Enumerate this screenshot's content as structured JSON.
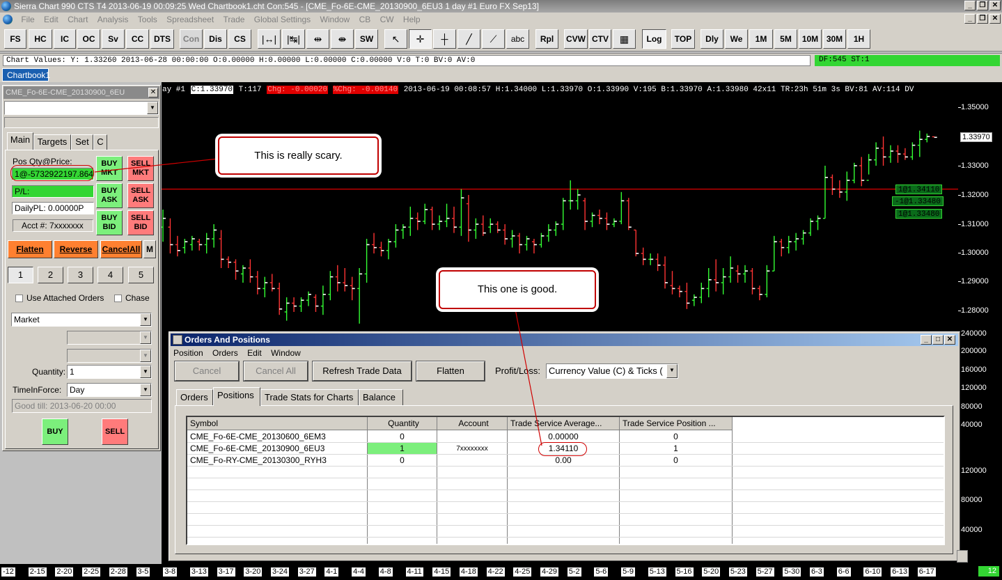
{
  "window": {
    "title": "Sierra Chart 990 CTS T4 2013-06-19  00:09:25 Wed  Chartbook1.cht Con:545 - [CME_Fo-6E-CME_20130900_6EU3  1 day  #1  Euro FX Sep13]"
  },
  "menu": [
    "File",
    "Edit",
    "Chart",
    "Analysis",
    "Tools",
    "Spreadsheet",
    "Trade",
    "Global Settings",
    "Window",
    "CB",
    "CW",
    "Help"
  ],
  "toolbar": {
    "buttons": [
      "FS",
      "HC",
      "IC",
      "OC",
      "Sv",
      "CC",
      "DTS",
      "Con",
      "Dis",
      "CS",
      "SW",
      "abc",
      "Rpl",
      "CVW",
      "CTV",
      "Log",
      "TOP",
      "Dly",
      "We",
      "1M",
      "5M",
      "10M",
      "30M",
      "1H"
    ]
  },
  "values_bar": {
    "text": "Chart Values: Y: 1.33260  2013-06-28  00:00:00  O:0.00000  H:0.00000  L:0.00000  C:0.00000  V:0  T:0  BV:0  AV:0",
    "df": "DF:545  ST:1"
  },
  "chartbook_tab": "Chartbook1",
  "trade_window": {
    "title": "CME_Fo-6E-CME_20130900_6EU",
    "tabs": [
      "Main",
      "Targets",
      "Set",
      "C"
    ],
    "pos_label": "Pos Qty@Price:",
    "pos_value": "1@-5732922197.864",
    "pl_label": "P/L:",
    "daily_pl": "DailyPL: 0.00000P",
    "acct": "Acct #: 7xxxxxxx",
    "buttons": {
      "buy_mkt": [
        "BUY",
        "MKT"
      ],
      "sell_mkt": [
        "SELL",
        "MKT"
      ],
      "buy_ask": [
        "BUY",
        "ASK"
      ],
      "sell_ask": [
        "SELL",
        "ASK"
      ],
      "buy_bid": [
        "BUY",
        "BID"
      ],
      "sell_bid": [
        "SELL",
        "BID"
      ]
    },
    "flatten": "Flatten",
    "reverse": "Reverse",
    "cancel_all": "CancelAll",
    "m": "M",
    "numbers": [
      "1",
      "2",
      "3",
      "4",
      "5"
    ],
    "use_attached": "Use Attached Orders",
    "chase": "Chase",
    "order_type": "Market",
    "quantity_label": "Quantity:",
    "quantity": "1",
    "tif_label": "TimeInForce:",
    "tif": "Day",
    "good_till": "Good till: 2013-06-20 00:00",
    "buy": "BUY",
    "sell": "SELL"
  },
  "chart": {
    "info": {
      "prefix": "ay   #1 ",
      "c": "C:1.33970",
      "t": " T:117 ",
      "chg": "Chg: -0.00020",
      "pchg": "%Chg: -0.00140",
      "rest": " 2013-06-19 00:08:57 H:1.34000 L:1.33970 O:1.33990 V:195 B:1.33970 A:1.33980 42x11 TR:23h 51m 3s BV:81 AV:114 DV"
    },
    "order_labels": [
      "1@1.34110",
      "-1@1.33480",
      "1@1.33480"
    ],
    "colors": {
      "up": "#33ff33",
      "down": "#ff3333",
      "close_tick": "#ffffff",
      "hline": "#c00000"
    },
    "bars": [
      [
        1.315,
        1.304,
        1.309,
        1.312
      ],
      [
        1.312,
        1.3,
        1.309,
        1.303
      ],
      [
        1.306,
        1.299,
        1.303,
        1.301
      ],
      [
        1.305,
        1.3,
        1.302,
        1.304
      ],
      [
        1.306,
        1.301,
        1.303,
        1.305
      ],
      [
        1.305,
        1.301,
        1.304,
        1.303
      ],
      [
        1.307,
        1.3,
        1.303,
        1.305
      ],
      [
        1.31,
        1.302,
        1.305,
        1.308
      ],
      [
        1.308,
        1.295,
        1.305,
        1.298
      ],
      [
        1.299,
        1.295,
        1.298,
        1.297
      ],
      [
        1.298,
        1.291,
        1.297,
        1.294
      ],
      [
        1.296,
        1.29,
        1.293,
        1.295
      ],
      [
        1.298,
        1.29,
        1.295,
        1.292
      ],
      [
        1.294,
        1.286,
        1.292,
        1.288
      ],
      [
        1.292,
        1.285,
        1.288,
        1.29
      ],
      [
        1.293,
        1.287,
        1.29,
        1.288
      ],
      [
        1.29,
        1.279,
        1.288,
        1.281
      ],
      [
        1.285,
        1.277,
        1.28,
        1.283
      ],
      [
        1.285,
        1.28,
        1.283,
        1.282
      ],
      [
        1.285,
        1.28,
        1.282,
        1.284
      ],
      [
        1.287,
        1.282,
        1.284,
        1.286
      ],
      [
        1.286,
        1.28,
        1.285,
        1.282
      ],
      [
        1.289,
        1.279,
        1.282,
        1.286
      ],
      [
        1.294,
        1.284,
        1.286,
        1.292
      ],
      [
        1.296,
        1.287,
        1.292,
        1.29
      ],
      [
        1.295,
        1.287,
        1.29,
        1.289
      ],
      [
        1.292,
        1.284,
        1.289,
        1.288
      ],
      [
        1.295,
        1.276,
        1.288,
        1.293
      ],
      [
        1.305,
        1.29,
        1.293,
        1.303
      ],
      [
        1.307,
        1.3,
        1.303,
        1.302
      ],
      [
        1.304,
        1.299,
        1.302,
        1.301
      ],
      [
        1.305,
        1.298,
        1.301,
        1.304
      ],
      [
        1.31,
        1.302,
        1.304,
        1.308
      ],
      [
        1.31,
        1.305,
        1.308,
        1.309
      ],
      [
        1.316,
        1.306,
        1.309,
        1.312
      ],
      [
        1.314,
        1.308,
        1.312,
        1.311
      ],
      [
        1.317,
        1.31,
        1.311,
        1.315
      ],
      [
        1.316,
        1.308,
        1.315,
        1.31
      ],
      [
        1.313,
        1.308,
        1.31,
        1.311
      ],
      [
        1.317,
        1.309,
        1.311,
        1.312
      ],
      [
        1.316,
        1.307,
        1.312,
        1.309
      ],
      [
        1.322,
        1.306,
        1.309,
        1.319
      ],
      [
        1.32,
        1.304,
        1.317,
        1.308
      ],
      [
        1.312,
        1.305,
        1.308,
        1.31
      ],
      [
        1.313,
        1.306,
        1.31,
        1.307
      ],
      [
        1.312,
        1.307,
        1.309,
        1.31
      ],
      [
        1.311,
        1.307,
        1.31,
        1.308
      ],
      [
        1.31,
        1.303,
        1.308,
        1.305
      ],
      [
        1.308,
        1.302,
        1.305,
        1.306
      ],
      [
        1.307,
        1.3,
        1.306,
        1.303
      ],
      [
        1.306,
        1.301,
        1.303,
        1.305
      ],
      [
        1.305,
        1.3,
        1.304,
        1.303
      ],
      [
        1.307,
        1.302,
        1.303,
        1.306
      ],
      [
        1.31,
        1.304,
        1.306,
        1.308
      ],
      [
        1.311,
        1.306,
        1.308,
        1.31
      ],
      [
        1.319,
        1.308,
        1.31,
        1.318
      ],
      [
        1.325,
        1.315,
        1.318,
        1.318
      ],
      [
        1.322,
        1.315,
        1.318,
        1.32
      ],
      [
        1.319,
        1.308,
        1.318,
        1.311
      ],
      [
        1.314,
        1.309,
        1.311,
        1.313
      ],
      [
        1.315,
        1.31,
        1.313,
        1.312
      ],
      [
        1.314,
        1.308,
        1.312,
        1.31
      ],
      [
        1.312,
        1.309,
        1.31,
        1.311
      ],
      [
        1.321,
        1.31,
        1.311,
        1.318
      ],
      [
        1.319,
        1.308,
        1.318,
        1.309
      ],
      [
        1.308,
        1.299,
        1.308,
        1.3
      ],
      [
        1.302,
        1.296,
        1.3,
        1.298
      ],
      [
        1.3,
        1.296,
        1.298,
        1.298
      ],
      [
        1.3,
        1.294,
        1.298,
        1.296
      ],
      [
        1.299,
        1.288,
        1.296,
        1.29
      ],
      [
        1.294,
        1.286,
        1.289,
        1.288
      ],
      [
        1.289,
        1.285,
        1.288,
        1.287
      ],
      [
        1.29,
        1.281,
        1.287,
        1.283
      ],
      [
        1.286,
        1.282,
        1.284,
        1.285
      ],
      [
        1.29,
        1.283,
        1.285,
        1.288
      ],
      [
        1.295,
        1.285,
        1.288,
        1.291
      ],
      [
        1.298,
        1.287,
        1.291,
        1.29
      ],
      [
        1.295,
        1.286,
        1.29,
        1.292
      ],
      [
        1.299,
        1.29,
        1.292,
        1.295
      ],
      [
        1.296,
        1.29,
        1.294,
        1.293
      ],
      [
        1.296,
        1.29,
        1.293,
        1.294
      ],
      [
        1.295,
        1.286,
        1.294,
        1.288
      ],
      [
        1.289,
        1.284,
        1.288,
        1.286
      ],
      [
        1.296,
        1.285,
        1.286,
        1.294
      ],
      [
        1.306,
        1.294,
        1.294,
        1.304
      ],
      [
        1.305,
        1.299,
        1.304,
        1.302
      ],
      [
        1.306,
        1.3,
        1.302,
        1.304
      ],
      [
        1.307,
        1.301,
        1.304,
        1.305
      ],
      [
        1.308,
        1.303,
        1.305,
        1.307
      ],
      [
        1.312,
        1.306,
        1.307,
        1.311
      ],
      [
        1.313,
        1.308,
        1.311,
        1.312
      ],
      [
        1.33,
        1.312,
        1.312,
        1.326
      ],
      [
        1.327,
        1.32,
        1.326,
        1.322
      ],
      [
        1.325,
        1.319,
        1.322,
        1.321
      ],
      [
        1.328,
        1.318,
        1.321,
        1.325
      ],
      [
        1.331,
        1.324,
        1.325,
        1.33
      ],
      [
        1.333,
        1.323,
        1.33,
        1.325
      ],
      [
        1.334,
        1.327,
        1.325,
        1.332
      ],
      [
        1.338,
        1.33,
        1.332,
        1.336
      ],
      [
        1.34,
        1.33,
        1.336,
        1.333
      ],
      [
        1.337,
        1.331,
        1.333,
        1.335
      ],
      [
        1.337,
        1.331,
        1.335,
        1.334
      ],
      [
        1.336,
        1.332,
        1.334,
        1.333
      ],
      [
        1.338,
        1.332,
        1.333,
        1.337
      ],
      [
        1.342,
        1.333,
        1.337,
        1.339
      ],
      [
        1.341,
        1.338,
        1.339,
        1.34
      ],
      [
        1.34,
        1.3397,
        1.3399,
        1.3397
      ]
    ],
    "h_line_price": 1.322
  },
  "y_axis": {
    "labels": [
      "1.35000",
      "1.33000",
      "1.32000",
      "1.31000",
      "1.30000",
      "1.29000",
      "1.28000"
    ],
    "current": "1.33970",
    "volume_labels": [
      "240000",
      "200000",
      "160000",
      "120000",
      "80000",
      "40000",
      "120000",
      "80000",
      "40000"
    ]
  },
  "x_axis": {
    "labels": [
      "-12",
      "2-15",
      "2-20",
      "2-25",
      "2-28",
      "3-5",
      "3-8",
      "3-13",
      "3-17",
      "3-20",
      "3-24",
      "3-27",
      "4-1",
      "4-4",
      "4-8",
      "4-11",
      "4-15",
      "4-18",
      "4-22",
      "4-25",
      "4-29",
      "5-2",
      "5-6",
      "5-9",
      "5-13",
      "5-16",
      "5-20",
      "5-23",
      "5-27",
      "5-30",
      "6-3",
      "6-6",
      "6-10",
      "6-13",
      "6-17"
    ],
    "right_box": "12"
  },
  "orders_window": {
    "title": "Orders And Positions",
    "menu": [
      "Position",
      "Orders",
      "Edit",
      "Window"
    ],
    "buttons": [
      "Cancel",
      "Cancel All",
      "Refresh Trade Data",
      "Flatten"
    ],
    "pl_label": "Profit/Loss:",
    "pl_value": "Currency Value (C) & Ticks (",
    "tabs": [
      "Orders",
      "Positions",
      "Trade Stats for Charts",
      "Balance"
    ],
    "columns": [
      "Symbol",
      "Quantity",
      "Account",
      "Trade Service Average...",
      "Trade Service Position ..."
    ],
    "rows": [
      [
        "CME_Fo-6E-CME_20130600_6EM3",
        "0",
        "",
        "0.00000",
        "0"
      ],
      [
        "CME_Fo-6E-CME_20130900_6EU3",
        "1",
        "7xxxxxxxx",
        "1.34110",
        "1"
      ],
      [
        "CME_Fo-RY-CME_20130300_RYH3",
        "0",
        "",
        "0.00",
        "0"
      ]
    ]
  },
  "annotations": {
    "scary": "This is really scary.",
    "good": "This one is good."
  }
}
